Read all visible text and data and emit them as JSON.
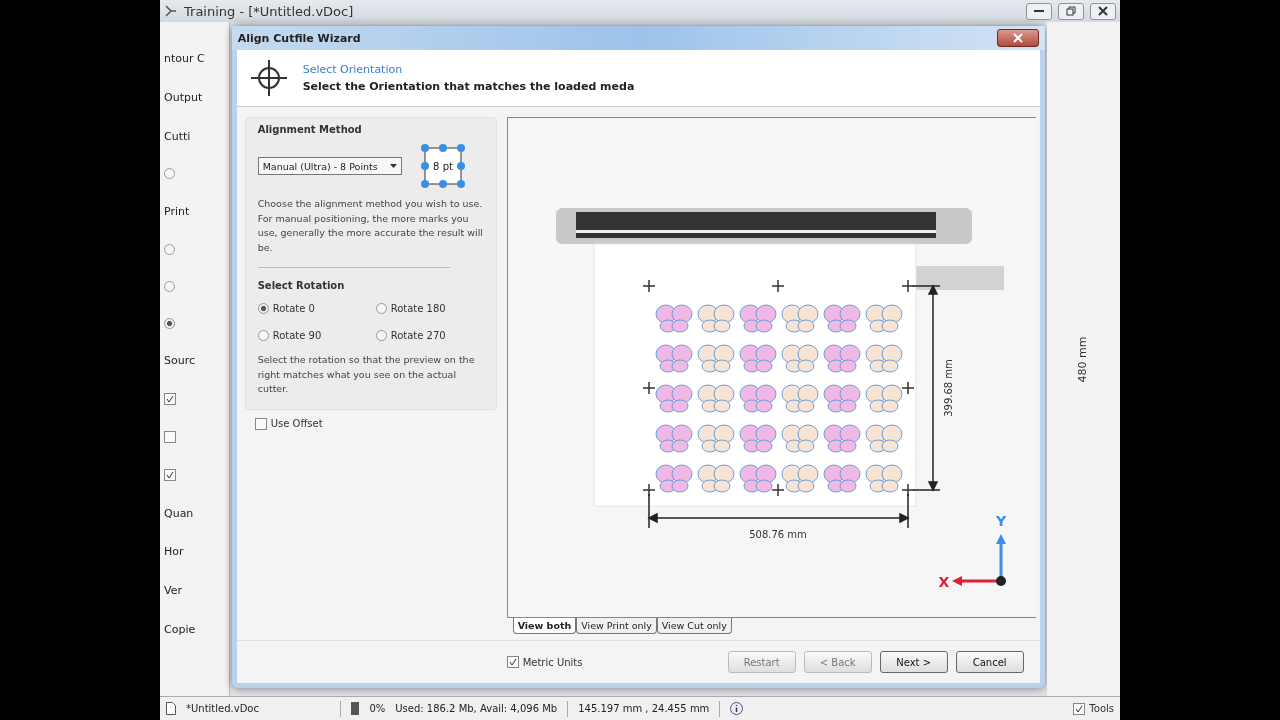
{
  "app": {
    "title": "Training - [*Untitled.vDoc]"
  },
  "background_panel": {
    "items": [
      {
        "kind": "text",
        "label": "ntour C"
      },
      {
        "kind": "text",
        "label": "Output"
      },
      {
        "kind": "text",
        "label": "Cutti"
      },
      {
        "kind": "radio",
        "selected": false
      },
      {
        "kind": "text",
        "label": "Print"
      },
      {
        "kind": "radio",
        "selected": false
      },
      {
        "kind": "radio",
        "selected": false
      },
      {
        "kind": "radio",
        "selected": true
      },
      {
        "kind": "text",
        "label": "Sourc"
      },
      {
        "kind": "checkbox",
        "checked": true
      },
      {
        "kind": "checkbox",
        "checked": false
      },
      {
        "kind": "checkbox",
        "checked": true
      },
      {
        "kind": "text",
        "label": "Quan"
      },
      {
        "kind": "text",
        "label": "Hor"
      },
      {
        "kind": "text",
        "label": "Ver"
      },
      {
        "kind": "text",
        "label": "Copie"
      }
    ],
    "right_label": "480 mm"
  },
  "wizard": {
    "title": "Align Cutfile Wizard",
    "heading": "Select Orientation",
    "subheading": "Select the Orientation that matches the loaded meda",
    "alignment": {
      "title": "Alignment Method",
      "method": "Manual (Ultra) - 8 Points",
      "marks_label": "8 pt",
      "description": "Choose the alignment method you wish to use. For manual positioning, the more marks you use, generally the more accurate the result will be."
    },
    "rotation": {
      "title": "Select Rotation",
      "options": [
        {
          "label": "Rotate 0",
          "selected": true
        },
        {
          "label": "Rotate 180",
          "selected": false
        },
        {
          "label": "Rotate 90",
          "selected": false
        },
        {
          "label": "Rotate 270",
          "selected": false
        }
      ],
      "description": "Select the rotation so that the preview on the right matches what you see on the actual cutter."
    },
    "use_offset": {
      "label": "Use Offset",
      "checked": false
    },
    "preview": {
      "height_label": "399.68 mm",
      "width_label": "508.76 mm",
      "y_axis": "Y",
      "x_axis": "X",
      "view_tabs": [
        {
          "label": "View both",
          "selected": true
        },
        {
          "label": "View Print only",
          "selected": false
        },
        {
          "label": "View Cut only",
          "selected": false
        }
      ]
    },
    "metric_units": {
      "label": "Metric Units",
      "checked": true
    },
    "buttons": [
      {
        "label": "Restart",
        "kind": "secondary"
      },
      {
        "label": "< Back",
        "kind": "secondary"
      },
      {
        "label": "Next >",
        "kind": "primary"
      },
      {
        "label": "Cancel",
        "kind": "primary"
      }
    ]
  },
  "status_bar": {
    "file": "*Untitled.vDoc",
    "progress": "0%",
    "memory": "Used: 186.2 Mb, Avail: 4,096 Mb",
    "position": "145.197 mm , 24.455 mm",
    "tools": {
      "label": "Tools",
      "checked": true
    }
  }
}
